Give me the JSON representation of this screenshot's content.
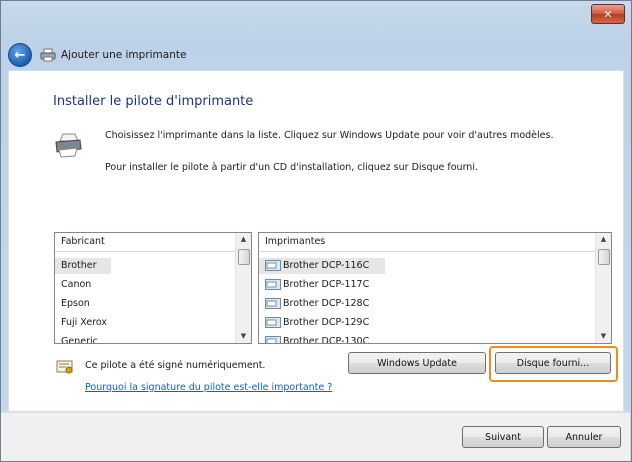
{
  "window": {
    "title": "Ajouter une imprimante",
    "close_glyph": "✕"
  },
  "icons": {
    "back": "back-arrow-icon",
    "printer": "printer-icon",
    "close": "close-icon",
    "signed": "certificate-icon",
    "driver": "printer-driver-icon"
  },
  "main": {
    "heading": "Installer le pilote d'imprimante",
    "line1": "Choisissez l'imprimante dans la liste. Cliquez sur Windows Update pour voir d'autres modèles.",
    "line2": "Pour installer le pilote à partir d'un CD d'installation, cliquez sur Disque fourni."
  },
  "manufacturers": {
    "header": "Fabricant",
    "items": [
      "Brother",
      "Canon",
      "Epson",
      "Fuji Xerox",
      "Generic"
    ],
    "selected_index": 0
  },
  "printers": {
    "header": "Imprimantes",
    "items": [
      "Brother DCP-116C",
      "Brother DCP-117C",
      "Brother DCP-128C",
      "Brother DCP-129C",
      "Brother DCP-130C"
    ],
    "selected_index": 0
  },
  "signature": {
    "text": "Ce pilote a été signé numériquement.",
    "link": "Pourquoi la signature du pilote est-elle importante ?"
  },
  "buttons": {
    "windows_update": "Windows Update",
    "have_disk": "Disque fourni...",
    "next": "Suivant",
    "cancel": "Annuler"
  },
  "colors": {
    "heading": "#1e3287",
    "highlight": "#f08a1c",
    "link": "#0066cc"
  }
}
